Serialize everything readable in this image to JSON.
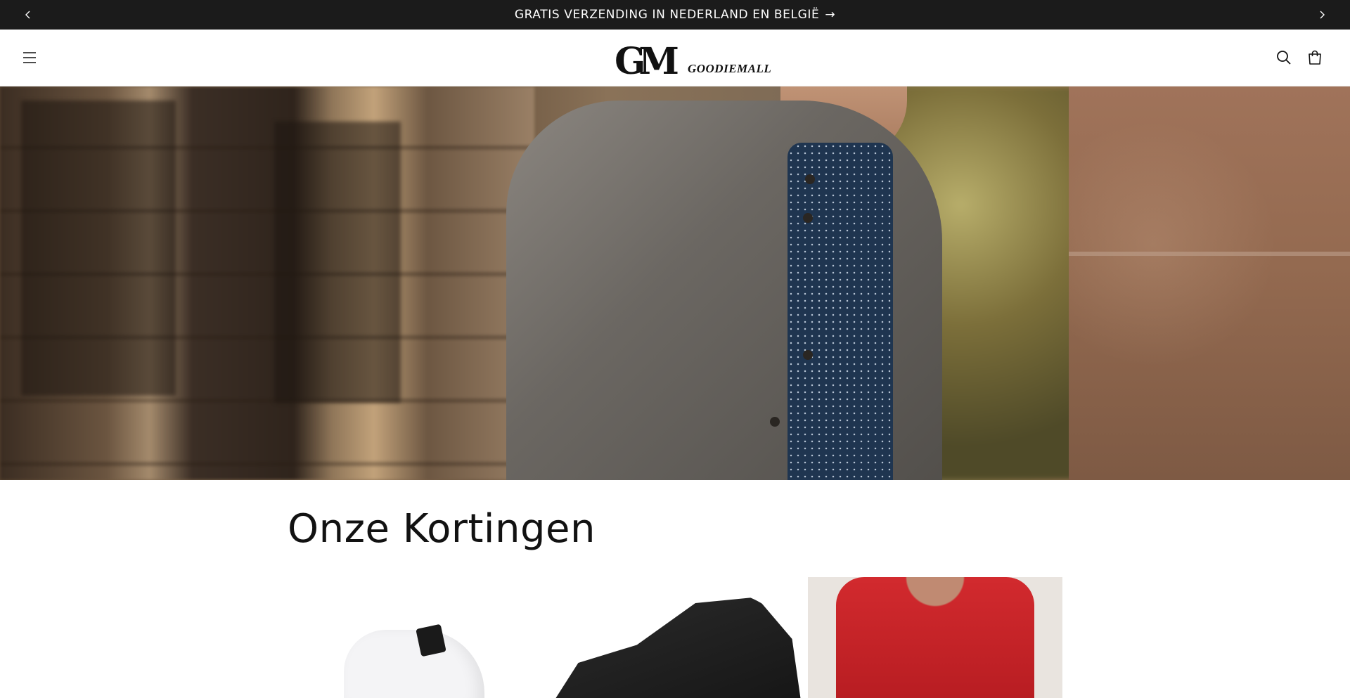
{
  "announcement": {
    "text": "GRATIS VERZENDING IN NEDERLAND EN BELGIË",
    "arrow": "→"
  },
  "header": {
    "logo_mark": "GM",
    "logo_word": "GOODIEMALL",
    "icons": [
      "menu-icon",
      "search-icon",
      "cart-icon"
    ]
  },
  "section": {
    "title": "Onze Kortingen"
  },
  "products": [
    {
      "image": "white-sneaker"
    },
    {
      "image": "black-sock-sneaker"
    },
    {
      "image": "red-sweater"
    }
  ],
  "colors": {
    "announcement_bg": "#1b1b1b",
    "text": "#121212",
    "background": "#ffffff"
  }
}
